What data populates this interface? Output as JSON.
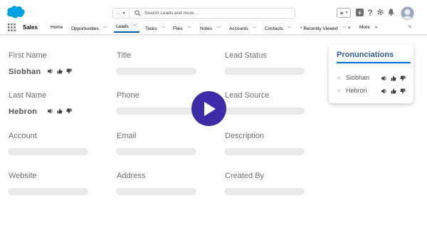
{
  "header": {
    "search": {
      "scope_label": "...",
      "placeholder": "Search Leads and more..."
    },
    "favorites_label": "★"
  },
  "nav": {
    "app_name": "Sales",
    "items": [
      {
        "label": "Home",
        "has_menu": false
      },
      {
        "label": "Opportunities",
        "has_menu": true
      },
      {
        "label": "Leads",
        "has_menu": true,
        "active": true
      },
      {
        "label": "Tasks",
        "has_menu": true
      },
      {
        "label": "Files",
        "has_menu": true
      },
      {
        "label": "Notes",
        "has_menu": true
      },
      {
        "label": "Accounts",
        "has_menu": true
      },
      {
        "label": "Contacts",
        "has_menu": true
      },
      {
        "label": "* Recently Viewed",
        "has_menu": true
      },
      {
        "label": "More",
        "has_menu": true
      }
    ],
    "close_label": "✕"
  },
  "fields": {
    "first_name": {
      "label": "First Name",
      "value": "Siobhan"
    },
    "last_name": {
      "label": "Last Name",
      "value": "Hebron"
    },
    "title": {
      "label": "Title"
    },
    "phone": {
      "label": "Phone"
    },
    "lead_status": {
      "label": "Lead Status"
    },
    "lead_source": {
      "label": "Lead Source"
    },
    "account": {
      "label": "Account"
    },
    "email": {
      "label": "Email"
    },
    "description": {
      "label": "Description"
    },
    "website": {
      "label": "Website"
    },
    "address": {
      "label": "Address"
    },
    "created_by": {
      "label": "Created By"
    }
  },
  "pronunciations": {
    "title": "Pronunciations",
    "items": [
      {
        "name": "Siobhan"
      },
      {
        "name": "Hebron"
      }
    ]
  },
  "colors": {
    "accent": "#0070d2",
    "play_button": "#3c2ca8",
    "card_title": "#2f5f93",
    "salesforce_blue": "#00a1e0"
  },
  "icons": {
    "speaker": "speaker-icon",
    "thumbs_up": "thumbs-up-icon",
    "thumbs_down": "thumbs-down-icon",
    "play": "play-icon"
  }
}
